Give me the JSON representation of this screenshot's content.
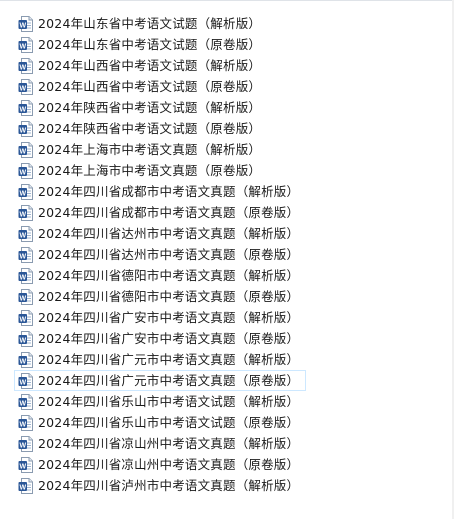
{
  "file_list": {
    "icon": "word-document-icon",
    "icon_letter": "W",
    "icon_color": "#2b5797",
    "selected_index": 17,
    "items": [
      {
        "name": "2024年山东省中考语文试题（解析版）"
      },
      {
        "name": "2024年山东省中考语文试题（原卷版）"
      },
      {
        "name": "2024年山西省中考语文试题（解析版）"
      },
      {
        "name": "2024年山西省中考语文试题（原卷版）"
      },
      {
        "name": "2024年陕西省中考语文试题（解析版）"
      },
      {
        "name": "2024年陕西省中考语文试题（原卷版）"
      },
      {
        "name": "2024年上海市中考语文真题（解析版）"
      },
      {
        "name": "2024年上海市中考语文真题（原卷版）"
      },
      {
        "name": "2024年四川省成都市中考语文真题（解析版）"
      },
      {
        "name": "2024年四川省成都市中考语文真题（原卷版）"
      },
      {
        "name": "2024年四川省达州市中考语文真题（解析版）"
      },
      {
        "name": "2024年四川省达州市中考语文真题（原卷版）"
      },
      {
        "name": "2024年四川省德阳市中考语文真题（解析版）"
      },
      {
        "name": "2024年四川省德阳市中考语文真题（原卷版）"
      },
      {
        "name": "2024年四川省广安市中考语文真题（解析版）"
      },
      {
        "name": "2024年四川省广安市中考语文真题（原卷版）"
      },
      {
        "name": "2024年四川省广元市中考语文真题（解析版）"
      },
      {
        "name": "2024年四川省广元市中考语文真题（原卷版）"
      },
      {
        "name": "2024年四川省乐山市中考语文试题（解析版）"
      },
      {
        "name": "2024年四川省乐山市中考语文试题（原卷版）"
      },
      {
        "name": "2024年四川省凉山州中考语文真题（解析版）"
      },
      {
        "name": "2024年四川省凉山州中考语文真题（原卷版）"
      },
      {
        "name": "2024年四川省泸州市中考语文真题（解析版）"
      }
    ]
  }
}
